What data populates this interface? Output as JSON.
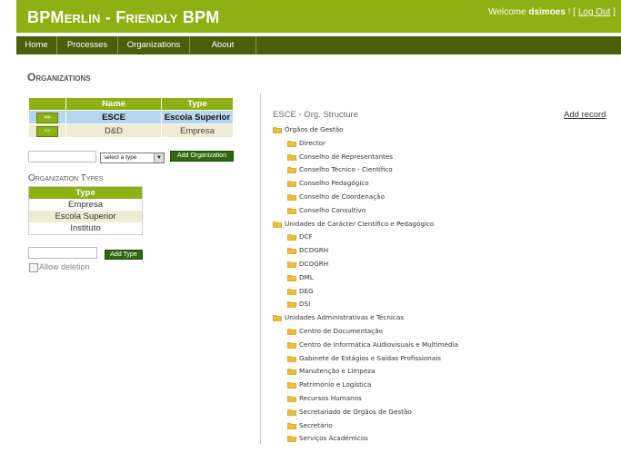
{
  "header": {
    "brand": "BPMerlin - Friendly BPM",
    "welcome_text": "Welcome",
    "username": "dsimoes",
    "logout_open": "! [",
    "logout_label": "Log Out",
    "logout_close": "]"
  },
  "nav": {
    "items": [
      {
        "label": "Home"
      },
      {
        "label": "Processes"
      },
      {
        "label": "Organizations"
      },
      {
        "label": "About"
      }
    ]
  },
  "page": {
    "title": "Organizations"
  },
  "organizations_table": {
    "headers": [
      "",
      "Name",
      "Type"
    ],
    "go_label": ">>",
    "rows": [
      {
        "name": "ESCE",
        "type": "Escola Superior"
      },
      {
        "name": "D&D",
        "type": "Empresa"
      }
    ]
  },
  "add_organization": {
    "name_value": "",
    "type_select_value": "select a type",
    "button_label": "Add Organization"
  },
  "organization_types": {
    "title": "Organization Types",
    "header": "Type",
    "rows": [
      "Empresa",
      "Escola Superior",
      "Instituto"
    ]
  },
  "add_type": {
    "name_value": "",
    "button_label": "Add Type"
  },
  "allow_deletion": {
    "label": "Allow deletion",
    "checked": false
  },
  "structure": {
    "title": "ESCE - Org. Structure",
    "add_record_label": "Add record",
    "folder_color": "#f0c030",
    "groups": [
      {
        "label": "Órgãos de Gestão",
        "children": [
          "Director",
          "Conselho de Representantes",
          "Conselho Técnico - Científico",
          "Conselho Pedagógico",
          "Conselho de Coordenação",
          "Conselho Consultivo"
        ]
      },
      {
        "label": "Unidades de Carácter Científico e Pedagógico",
        "children": [
          "DCF",
          "DCOGRH",
          "DCOGRH",
          "DML",
          "DEG",
          "DSI"
        ]
      },
      {
        "label": "Unidades Administrativas e Técnicas",
        "children": [
          "Centro de Documentação",
          "Centro de Informática Audiovisuais e Multimédia",
          "Gabinete de Estágios e Saídas Profissionais",
          "Manutenção e Limpeza",
          "Património e Logística",
          "Recursos Humanos",
          "Secretariado de Orgãos de Gestão",
          "Secretário",
          "Serviços Académicos"
        ]
      }
    ]
  },
  "colors": {
    "brand_green": "#8db012",
    "nav_dark_green": "#4c5f08",
    "button_dark_green": "#2f6a12",
    "selected_row_blue": "#b6d6ee",
    "alt_row_beige": "#ecedd2"
  }
}
